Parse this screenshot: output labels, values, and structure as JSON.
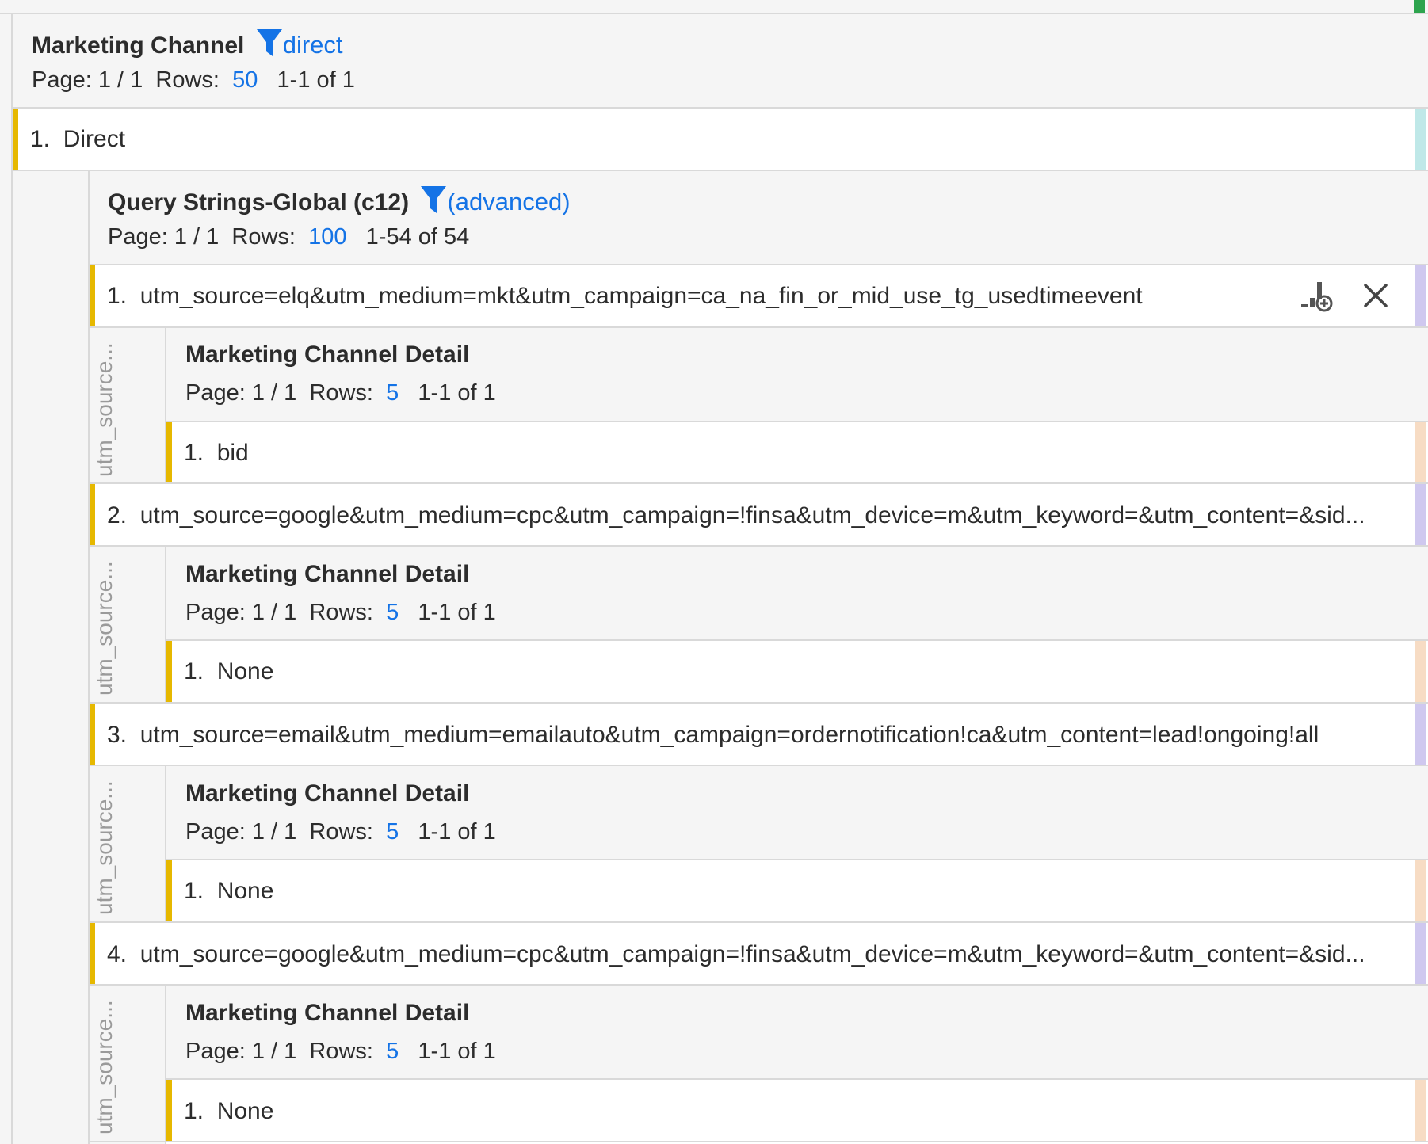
{
  "top_panel": {
    "title": "Marketing Channel",
    "filter_label": "direct",
    "page_label": "Page: 1 / 1",
    "rows_label": "Rows:",
    "rows_value": "50",
    "range_label": "1-1 of 1",
    "row": {
      "num": "1.",
      "label": "Direct"
    }
  },
  "query_panel": {
    "title": "Query Strings-Global (c12)",
    "filter_label": "(advanced)",
    "page_label": "Page: 1 / 1",
    "rows_label": "Rows:",
    "rows_value": "100",
    "range_label": "1-54 of 54"
  },
  "query_rows": [
    {
      "num": "1.",
      "label": "utm_source=elq&utm_medium=mkt&utm_campaign=ca_na_fin_or_mid_use_tg_usedtimeevent",
      "side_label": "utm_source...",
      "detail": {
        "title": "Marketing Channel Detail",
        "page_label": "Page: 1 / 1",
        "rows_label": "Rows:",
        "rows_value": "5",
        "range_label": "1-1 of 1",
        "row_num": "1.",
        "row_label": "bid"
      }
    },
    {
      "num": "2.",
      "label": "utm_source=google&utm_medium=cpc&utm_campaign=!finsa&utm_device=m&utm_keyword=&utm_content=&sid...",
      "side_label": "utm_source...",
      "detail": {
        "title": "Marketing Channel Detail",
        "page_label": "Page: 1 / 1",
        "rows_label": "Rows:",
        "rows_value": "5",
        "range_label": "1-1 of 1",
        "row_num": "1.",
        "row_label": "None"
      }
    },
    {
      "num": "3.",
      "label": "utm_source=email&utm_medium=emailauto&utm_campaign=ordernotification!ca&utm_content=lead!ongoing!all",
      "side_label": "utm_source...",
      "detail": {
        "title": "Marketing Channel Detail",
        "page_label": "Page: 1 / 1",
        "rows_label": "Rows:",
        "rows_value": "5",
        "range_label": "1-1 of 1",
        "row_num": "1.",
        "row_label": "None"
      }
    },
    {
      "num": "4.",
      "label": "utm_source=google&utm_medium=cpc&utm_campaign=!finsa&utm_device=m&utm_keyword=&utm_content=&sid...",
      "side_label": "utm_source...",
      "detail": {
        "title": "Marketing Channel Detail",
        "page_label": "Page: 1 / 1",
        "rows_label": "Rows:",
        "rows_value": "5",
        "range_label": "1-1 of 1",
        "row_num": "1.",
        "row_label": "None"
      }
    }
  ],
  "icons": {
    "filter": "filter-icon",
    "add_visualization": "add-visualization-icon",
    "close": "close-icon"
  },
  "colors": {
    "accent_blue": "#1473e6",
    "row_highlight": "#e6b800",
    "right_teal": "#bfe8e8",
    "right_purple": "#cfc8ef",
    "right_peach": "#f7dcc4",
    "top_green": "#2da44e"
  }
}
